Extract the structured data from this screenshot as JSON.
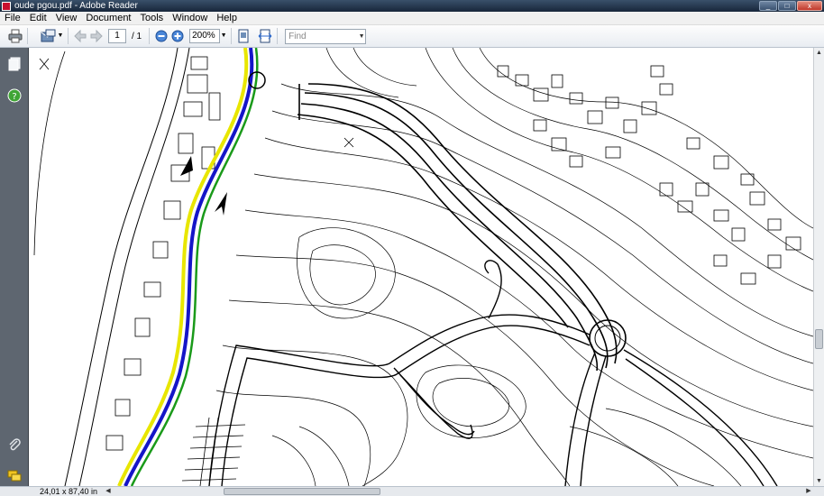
{
  "window": {
    "title": "oude pgou.pdf - Adobe Reader",
    "controls": {
      "minimize": "_",
      "maximize": "□",
      "close": "x"
    }
  },
  "menu": [
    "File",
    "Edit",
    "View",
    "Document",
    "Tools",
    "Window",
    "Help"
  ],
  "toolbar": {
    "page_current": "1",
    "page_total_label": "/ 1",
    "zoom_value": "200%",
    "find_placeholder": "Find",
    "dropdown_glyph": "▼"
  },
  "status": {
    "page_size": "24,01 x 87,40 in"
  },
  "colors": {
    "titlebar": "#1f3450",
    "route_yellow": "#e8e600",
    "route_blue": "#1515c8",
    "route_green": "#1a9a1a",
    "help_icon": "#3fa535"
  },
  "icons": {
    "left_nav": [
      "pages-icon",
      "help-icon",
      "attachment-icon",
      "comments-icon"
    ],
    "toolbar": [
      "print-icon",
      "email-icon",
      "prev-page-icon",
      "next-page-icon",
      "zoom-out-icon",
      "zoom-in-icon",
      "fit-page-icon",
      "fit-width-icon"
    ]
  }
}
